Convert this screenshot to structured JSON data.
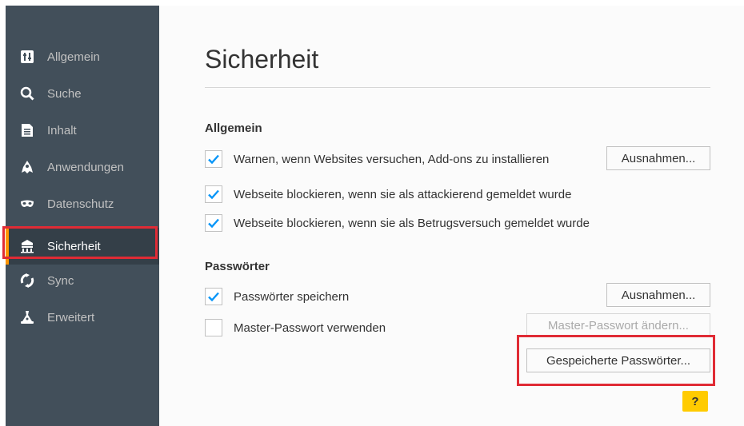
{
  "sidebar": {
    "items": [
      {
        "label": "Allgemein",
        "icon": "general-icon"
      },
      {
        "label": "Suche",
        "icon": "search-icon"
      },
      {
        "label": "Inhalt",
        "icon": "content-icon"
      },
      {
        "label": "Anwendungen",
        "icon": "applications-icon"
      },
      {
        "label": "Datenschutz",
        "icon": "privacy-mask-icon"
      },
      {
        "label": "Sicherheit",
        "icon": "security-icon",
        "selected": true
      },
      {
        "label": "Sync",
        "icon": "sync-icon"
      },
      {
        "label": "Erweitert",
        "icon": "advanced-icon"
      }
    ]
  },
  "main": {
    "title": "Sicherheit",
    "general": {
      "heading": "Allgemein",
      "warn_addons": {
        "label": "Warnen, wenn Websites versuchen, Add-ons zu installieren",
        "checked": true
      },
      "exceptions_button": "Ausnahmen...",
      "block_attack": {
        "label": "Webseite blockieren, wenn sie als attackierend gemeldet wurde",
        "checked": true
      },
      "block_fraud": {
        "label": "Webseite blockieren, wenn sie als Betrugsversuch gemeldet wurde",
        "checked": true
      }
    },
    "passwords": {
      "heading": "Passwörter",
      "save_passwords": {
        "label": "Passwörter speichern",
        "checked": true
      },
      "exceptions_button": "Ausnahmen...",
      "master_password": {
        "label": "Master-Passwort verwenden",
        "checked": false
      },
      "change_master_button": "Master-Passwort ändern...",
      "saved_passwords_button": "Gespeicherte Passwörter..."
    },
    "help_label": "?"
  },
  "colors": {
    "sidebar_bg": "#424f5a",
    "sidebar_selected_bg": "#343f48",
    "accent": "#ff9500",
    "highlight_red": "#e02b35",
    "checkmark": "#0996f8",
    "help_bg": "#ffcb00"
  }
}
